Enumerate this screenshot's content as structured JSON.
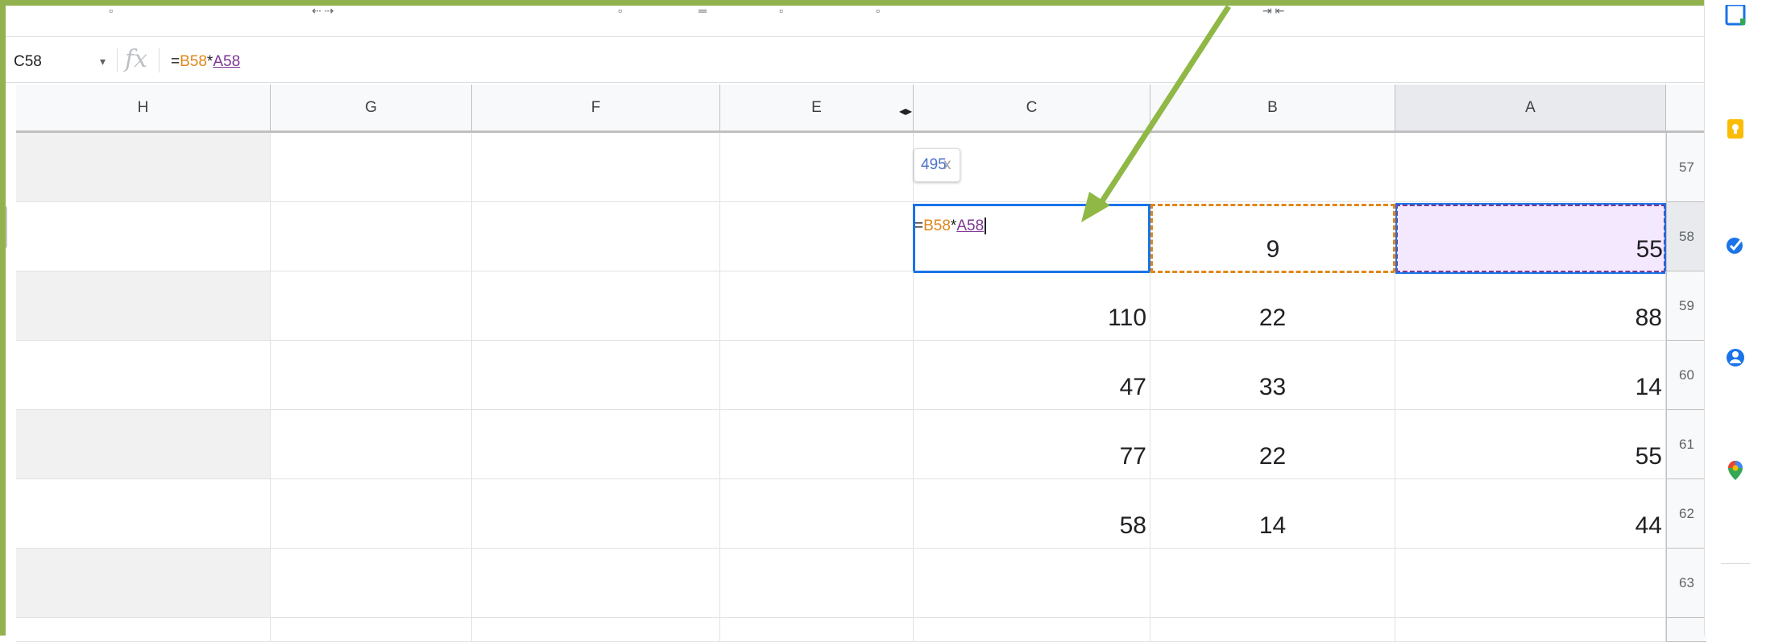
{
  "formula_bar": {
    "cell_ref": "C58",
    "caret": "▾",
    "fx": "fx",
    "formula_eq": "=",
    "formula_b": "B58",
    "formula_op": "*",
    "formula_a": "A58"
  },
  "columns": [
    "H",
    "G",
    "F",
    "E",
    "C",
    "B",
    "A"
  ],
  "rows": [
    {
      "num": "57",
      "C": "",
      "B": "",
      "A": ""
    },
    {
      "num": "58",
      "C": "",
      "B": "9",
      "A": "55"
    },
    {
      "num": "59",
      "C": "110",
      "B": "22",
      "A": "88"
    },
    {
      "num": "60",
      "C": "47",
      "B": "33",
      "A": "14"
    },
    {
      "num": "61",
      "C": "77",
      "B": "22",
      "A": "55"
    },
    {
      "num": "62",
      "C": "58",
      "B": "14",
      "A": "44"
    },
    {
      "num": "63",
      "C": "",
      "B": "",
      "A": ""
    }
  ],
  "tooltip": {
    "result": "495",
    "close": "x"
  },
  "colors": {
    "active": "#1a73e8",
    "ref_b": "#e3861a",
    "ref_a": "#7e3794",
    "frame": "#92b24f",
    "arrow": "#8fb846"
  },
  "side_icons": [
    "calendar-icon",
    "keep-icon",
    "tasks-icon",
    "contacts-icon",
    "maps-icon"
  ]
}
